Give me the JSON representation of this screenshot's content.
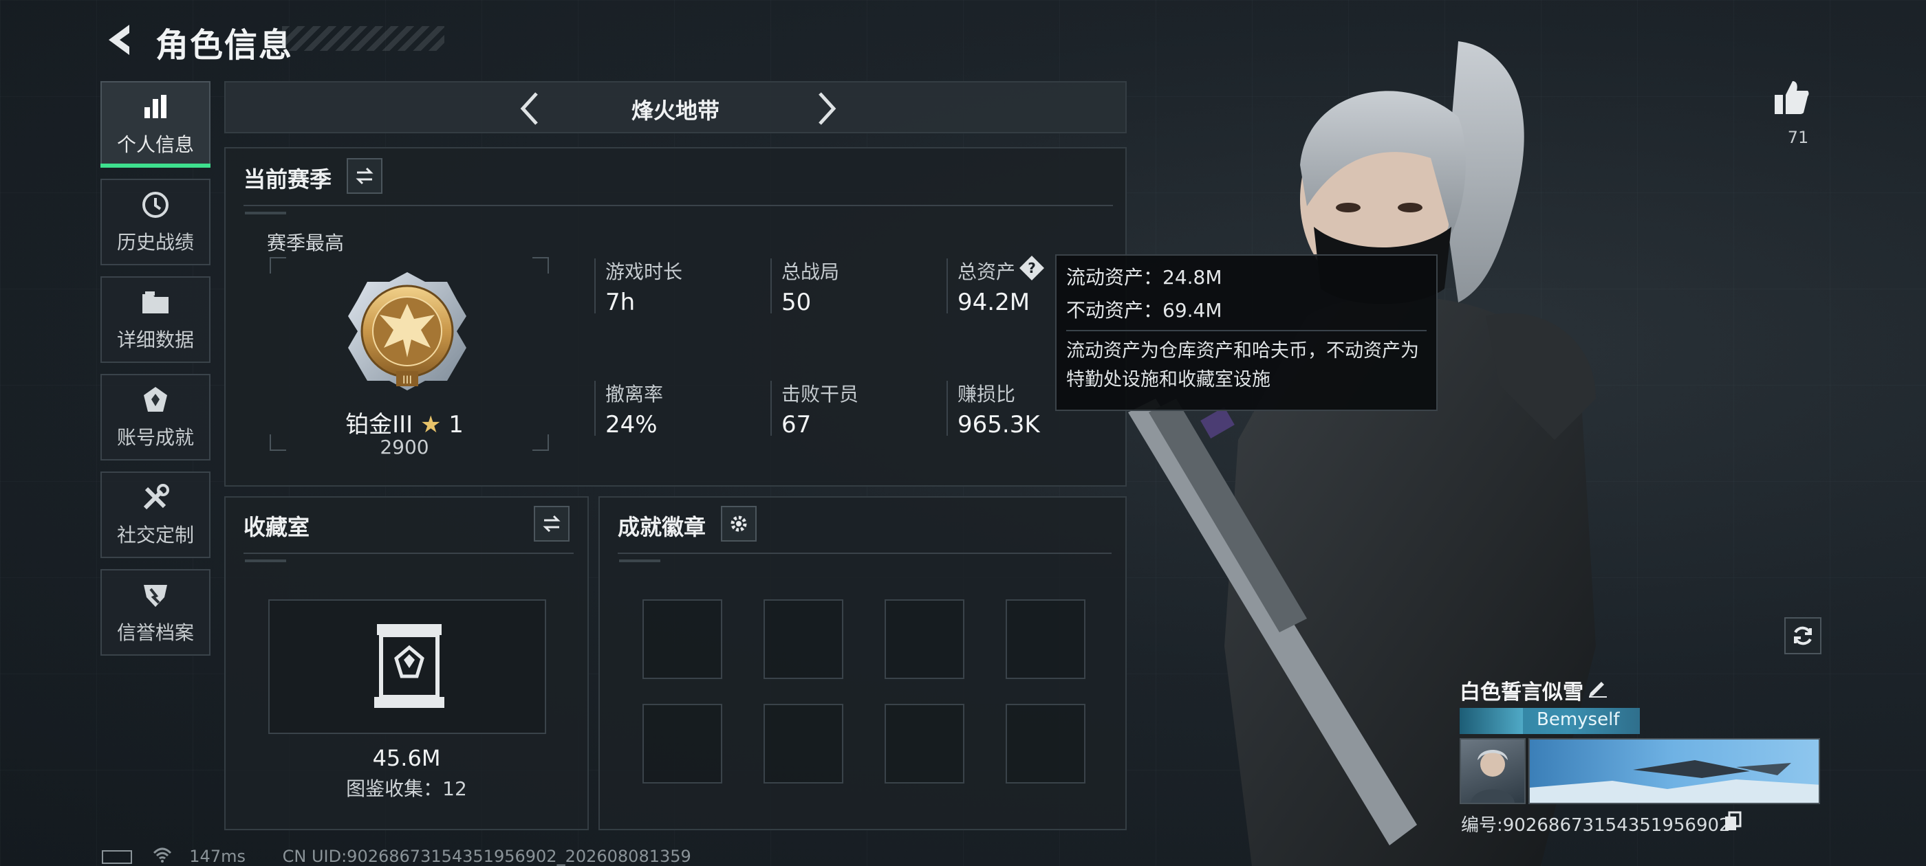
{
  "header": {
    "title": "角色信息"
  },
  "sidebar": {
    "items": [
      {
        "label": "个人信息",
        "icon": "bar-chart-icon",
        "active": true
      },
      {
        "label": "历史战绩",
        "icon": "history-icon",
        "active": false
      },
      {
        "label": "详细数据",
        "icon": "folder-icon",
        "active": false
      },
      {
        "label": "账号成就",
        "icon": "achievement-icon",
        "active": false
      },
      {
        "label": "社交定制",
        "icon": "tools-icon",
        "active": false
      },
      {
        "label": "信誉档案",
        "icon": "reputation-icon",
        "active": false
      }
    ]
  },
  "mode": {
    "title": "烽火地带"
  },
  "season": {
    "title": "当前赛季",
    "best_label": "赛季最高",
    "rank": "铂金III",
    "stars": "1",
    "score": "2900",
    "stats": [
      {
        "label": "游戏时长",
        "value": "7h"
      },
      {
        "label": "总战局",
        "value": "50"
      },
      {
        "label": "总资产",
        "value": "94.2M"
      },
      {
        "label": "撤离率",
        "value": "24%"
      },
      {
        "label": "击败干员",
        "value": "67"
      },
      {
        "label": "赚损比",
        "value": "965.3K"
      }
    ]
  },
  "tooltip": {
    "liquid": "流动资产：24.8M",
    "fixed": "不动资产：69.4M",
    "desc": "流动资产为仓库资产和哈夫币，不动资产为特勤处设施和收藏室设施"
  },
  "collection": {
    "title": "收藏室",
    "value": "45.6M",
    "count_text": "图鉴收集：12"
  },
  "badges": {
    "title": "成就徽章",
    "slots": 8
  },
  "likes": {
    "count": "71"
  },
  "player": {
    "name": "白色誓言似雪",
    "title_tag": "Bemyself",
    "id_text": "编号:90268673154351956902"
  },
  "status": {
    "ping": "147ms",
    "uid": "CN UID:90268673154351956902_202608081359"
  },
  "colors": {
    "accent": "#3ee08e",
    "panel": "#1b2126",
    "border": "#343d43"
  }
}
